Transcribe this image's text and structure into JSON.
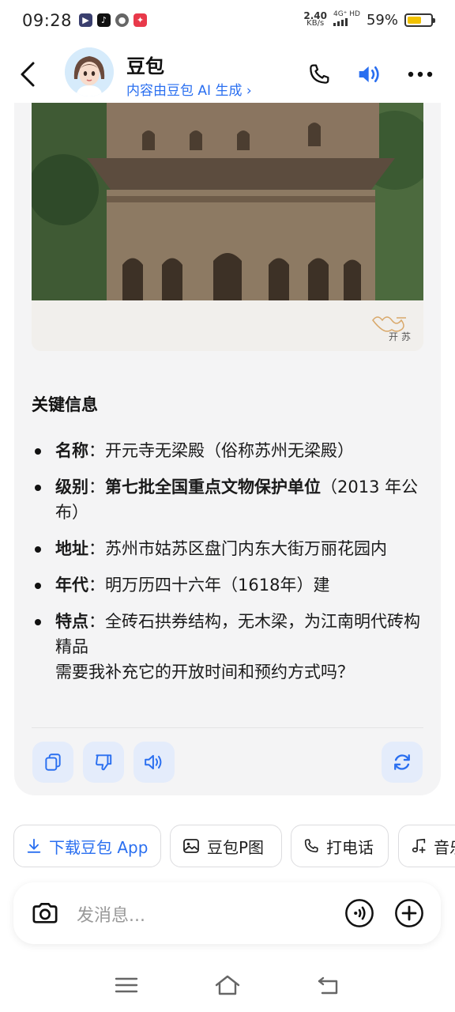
{
  "status_bar": {
    "time": "09:28",
    "net_speed_value": "2.40",
    "net_speed_unit": "KB/s",
    "network_type": "4G⁺ HD",
    "battery_percent": "59%",
    "battery_level": 0.59
  },
  "header": {
    "title": "豆包",
    "subtitle": "内容由豆包 AI 生成 ›"
  },
  "photo": {
    "caption": "开苏"
  },
  "message": {
    "section_title": "关键信息",
    "items": [
      {
        "key": "名称",
        "sep": "：",
        "value": "开元寺无梁殿（俗称苏州无梁殿）"
      },
      {
        "key": "级别",
        "sep": "：",
        "bold_value": "第七批全国重点文物保护单位",
        "value": "（2013 年公布）"
      },
      {
        "key": "地址",
        "sep": "：",
        "value": "苏州市姑苏区盘门内东大街万丽花园内"
      },
      {
        "key": "年代",
        "sep": "：",
        "value": "明万历四十六年（1618年）建"
      },
      {
        "key": "特点",
        "sep": "：",
        "value": "全砖石拱券结构，无木梁，为江南明代砖构精品",
        "followup": "需要我补充它的开放时间和预约方式吗？"
      }
    ]
  },
  "chips": [
    {
      "label": "下载豆包 App",
      "icon": "download-icon"
    },
    {
      "label": "豆包P图",
      "icon": "image-edit-icon"
    },
    {
      "label": "打电话",
      "icon": "phone-icon"
    },
    {
      "label": "音乐",
      "icon": "music-icon"
    }
  ],
  "composer": {
    "placeholder": "发消息..."
  },
  "colors": {
    "accent": "#2a6ff0",
    "card_bg": "#f4f4f5",
    "action_bg": "#e4ecfb",
    "battery": "#f2c200"
  }
}
